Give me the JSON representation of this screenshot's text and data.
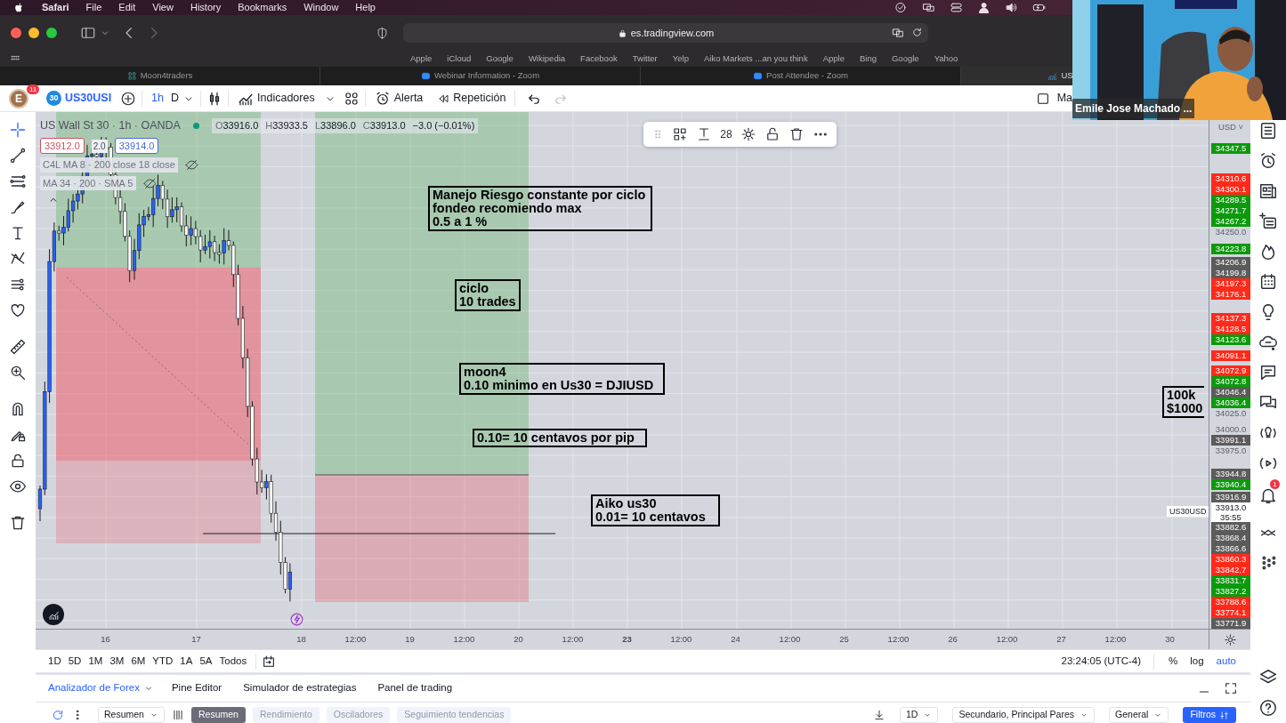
{
  "menu_bar": {
    "app": "Safari",
    "items": [
      "File",
      "Edit",
      "View",
      "History",
      "Bookmarks",
      "Window",
      "Help"
    ]
  },
  "browser": {
    "address": "es.tradingview.com",
    "bookmarks": [
      "Apple",
      "iCloud",
      "Google",
      "Wikipedia",
      "Facebook",
      "Twitter",
      "Yelp",
      "Aiko Markets ...an you think",
      "Apple",
      "Bing",
      "Google",
      "Yahoo"
    ],
    "tabs": [
      {
        "title": "Moon4traders",
        "selected": false
      },
      {
        "title": "Webinar Information - Zoom",
        "selected": false
      },
      {
        "title": "Post Attendee - Zoom",
        "selected": false
      },
      {
        "title": "US",
        "selected": true
      }
    ]
  },
  "webcam": {
    "kind": "picture",
    "name": "Emile Jose Machado ..."
  },
  "toolbar": {
    "avatar": "E",
    "notifications": "11",
    "symbol_badge": "30",
    "symbol": "US30USI",
    "intervals": [
      {
        "label": "1h",
        "selected": true
      },
      {
        "label": "D",
        "selected": false
      }
    ],
    "indicators": "Indicadores",
    "alert": "Alerta",
    "replay": "Repetición",
    "layout": "Ma"
  },
  "legend": {
    "title": "US Wall St 30 · 1h · OANDA",
    "ohlc": [
      {
        "label": "O",
        "value": "33916.0"
      },
      {
        "label": "H",
        "value": "33933.5"
      },
      {
        "label": "L",
        "value": "33896.0"
      },
      {
        "label": "C",
        "value": "33913.0"
      }
    ],
    "change": "−3.0 (−0.01%)",
    "sell": "33912.0",
    "spread": "2.0",
    "buy": "33914.0",
    "indicators": [
      "C4L MA 8 · 200 close 18 close",
      "MA 34 · 200 · SMA 5"
    ]
  },
  "drawing_toolbar": {
    "font_size": "28"
  },
  "notes": [
    {
      "text": "Manejo Riesgo constante por ciclo\nfondeo recomiendo max\n0.5 a 1 %"
    },
    {
      "text": "ciclo\n10 trades"
    },
    {
      "text": "moon4\n0.10 minimo en Us30 = DJIUSD"
    },
    {
      "text": "0.10= 10 centavos por pip"
    },
    {
      "text": "Aiko us30\n0.01= 10 centavos"
    },
    {
      "text": "100k\n$1000"
    }
  ],
  "price_axis": {
    "currency": "USD ˅",
    "labels": [
      {
        "text": "34347.5",
        "color": "#0c9a0c"
      },
      {
        "text": "34310.6",
        "color": "#ff2a1a"
      },
      {
        "text": "34300.1",
        "color": "#ff2a1a"
      },
      {
        "text": "34289.5",
        "color": "#0c9a0c"
      },
      {
        "text": "34271.7",
        "color": "#0c9a0c"
      },
      {
        "text": "34267.2",
        "color": "#0c9a0c"
      },
      {
        "text": "34250.0"
      },
      {
        "text": "34223.8",
        "color": "#0c9a0c"
      },
      {
        "text": "34206.9",
        "color": "#5b5b5b"
      },
      {
        "text": "34199.8",
        "color": "#5b5b5b"
      },
      {
        "text": "34197.3",
        "color": "#ff2a1a"
      },
      {
        "text": "34176.1",
        "color": "#ff2a1a"
      },
      {
        "text": "34137.3",
        "color": "#ff2a1a"
      },
      {
        "text": "34128.5",
        "color": "#ff2a1a"
      },
      {
        "text": "34123.6",
        "color": "#0c9a0c"
      },
      {
        "text": "34091.1",
        "color": "#ff2a1a"
      },
      {
        "text": "34072.9",
        "color": "#ff2a1a"
      },
      {
        "text": "34072.8",
        "color": "#0c9a0c"
      },
      {
        "text": "34046.4",
        "color": "#5b5b5b"
      },
      {
        "text": "34036.4",
        "color": "#0c9a0c"
      },
      {
        "text": "34025.0"
      },
      {
        "text": "34000.0"
      },
      {
        "text": "33991.1",
        "color": "#5b5b5b"
      },
      {
        "text": "33975.0"
      },
      {
        "text": "33944.8",
        "color": "#5b5b5b"
      },
      {
        "text": "33940.4",
        "color": "#0c9a0c"
      },
      {
        "text": "33916.9",
        "color": "#5b5b5b"
      },
      {
        "text": "33913.0",
        "kind": "current",
        "countdown": "35:55",
        "symbol": "US30USD"
      },
      {
        "text": "33882.6",
        "color": "#5b5b5b"
      },
      {
        "text": "33868.4",
        "color": "#5b5b5b"
      },
      {
        "text": "33866.6",
        "color": "#5b5b5b"
      },
      {
        "text": "33860.3",
        "color": "#ff2a1a"
      },
      {
        "text": "33842.7",
        "color": "#ff2a1a"
      },
      {
        "text": "33831.7",
        "color": "#0c9a0c"
      },
      {
        "text": "33827.2",
        "color": "#0c9a0c"
      },
      {
        "text": "33788.6",
        "color": "#ff2a1a"
      },
      {
        "text": "33774.1",
        "color": "#ff2a1a"
      },
      {
        "text": "33771.9",
        "color": "#5b5b5b"
      }
    ]
  },
  "time_axis": [
    {
      "text": "16",
      "bold": false
    },
    {
      "text": "17",
      "bold": false
    },
    {
      "text": "18",
      "bold": false
    },
    {
      "text": "12:00",
      "bold": false
    },
    {
      "text": "19",
      "bold": false
    },
    {
      "text": "12:00",
      "bold": false
    },
    {
      "text": "20",
      "bold": false
    },
    {
      "text": "12:00",
      "bold": false
    },
    {
      "text": "23",
      "bold": true
    },
    {
      "text": "12:00",
      "bold": false
    },
    {
      "text": "24",
      "bold": false
    },
    {
      "text": "12:00",
      "bold": false
    },
    {
      "text": "25",
      "bold": false
    },
    {
      "text": "12:00",
      "bold": false
    },
    {
      "text": "26",
      "bold": false
    },
    {
      "text": "12:00",
      "bold": false
    },
    {
      "text": "27",
      "bold": false
    },
    {
      "text": "12:00",
      "bold": false
    },
    {
      "text": "30",
      "bold": false
    }
  ],
  "ranges": [
    "1D",
    "5D",
    "1M",
    "3M",
    "6M",
    "YTD",
    "1A",
    "5A",
    "Todos"
  ],
  "clock": "23:24:05 (UTC-4)",
  "scale": [
    {
      "label": "%",
      "selected": false
    },
    {
      "label": "log",
      "selected": false
    },
    {
      "label": "auto",
      "selected": true
    }
  ],
  "alerts_badge": "1",
  "bottom_panel": {
    "tabs": [
      {
        "label": "Analizador de Forex",
        "selected": true
      },
      {
        "label": "Pine Editor",
        "selected": false
      },
      {
        "label": "Simulador de estrategias",
        "selected": false
      },
      {
        "label": "Panel de trading",
        "selected": false
      }
    ],
    "view_select": "Resumen",
    "subtabs": [
      {
        "label": "Resumen",
        "selected": true
      },
      {
        "label": "Rendimiento",
        "selected": false
      },
      {
        "label": "Osciladores",
        "selected": false
      },
      {
        "label": "Seguimiento tendencias",
        "selected": false
      }
    ],
    "interval_select": "1D",
    "pairs_select": "Secundario, Principal Pares",
    "group_select": "General",
    "filter": "Filtros"
  }
}
